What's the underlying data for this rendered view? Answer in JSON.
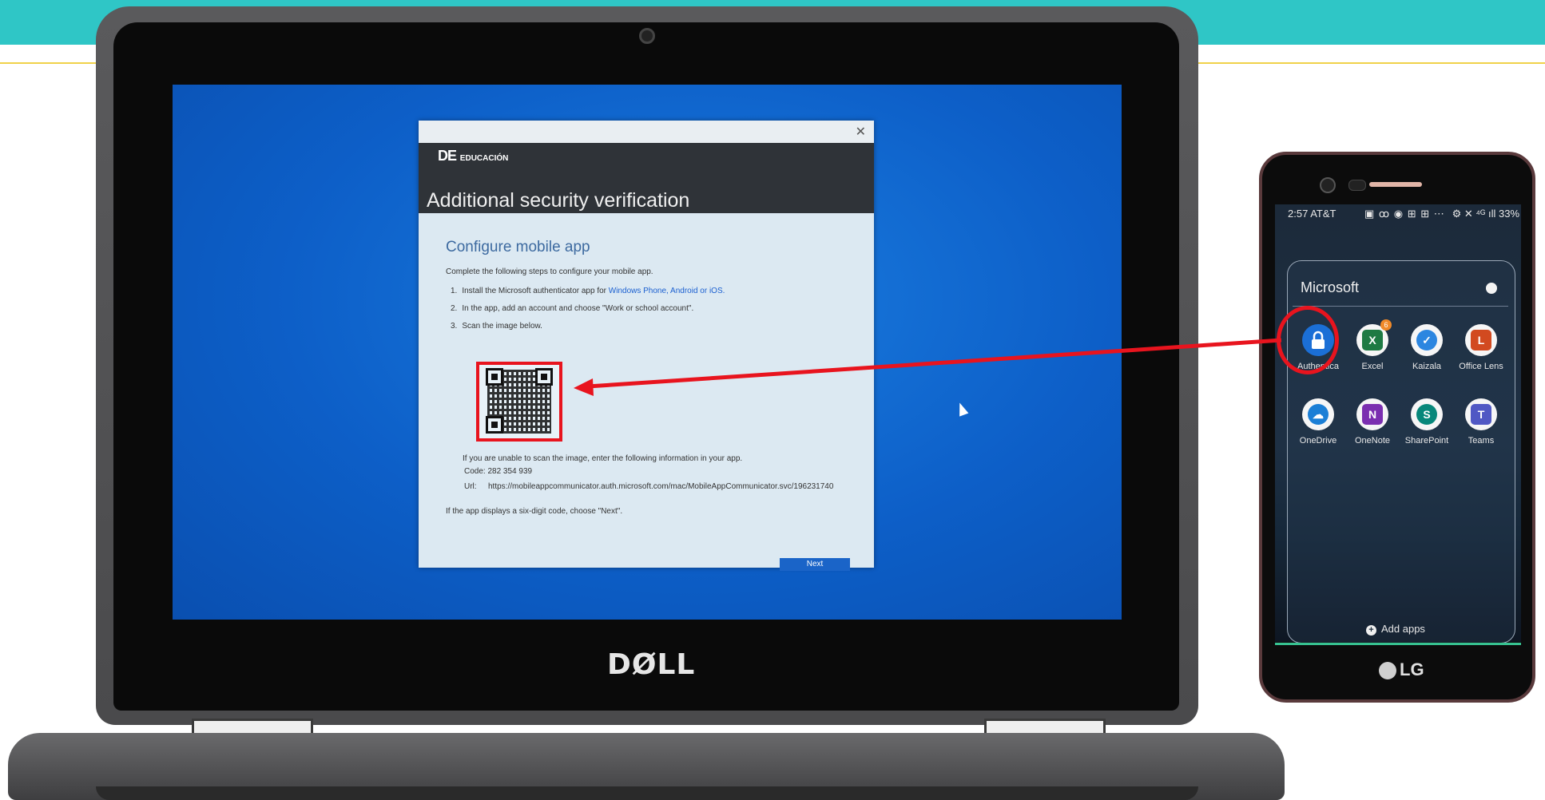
{
  "dialog": {
    "close_icon": "✕",
    "org_logo_initials": "DE",
    "org_logo_name": "EDUCACIÓN",
    "title": "Additional security verification",
    "heading": "Configure mobile app",
    "intro": "Complete the following steps to configure your mobile app.",
    "step1_prefix": "Install the Microsoft authenticator app for ",
    "step1_links": "Windows Phone, Android or iOS.",
    "step2": "In the app, add an account and choose \"Work or school account\".",
    "step3": "Scan the image below.",
    "unable_text": "If you are unable to scan the image, enter the following information in your app.",
    "code_label": "Code: 282 354 939",
    "url_label": "Url:",
    "url_value": "https://mobileappcommunicator.auth.microsoft.com/mac/MobileAppCommunicator.svc/196231740",
    "six_digit_text": "If the app displays a six-digit code, choose \"Next\".",
    "next_button": "Next"
  },
  "laptop": {
    "brand": "DØLL"
  },
  "phone": {
    "status_time": "2:57 AT&T",
    "status_icons": "▣ ꝏ ◉ ⊞ ⊞ ⋯",
    "status_right": "⚙ ✕ ⁴ᴳ ıll 33%",
    "folder_title": "Microsoft",
    "apps": [
      {
        "label": "Authentica",
        "icon": "lock-icon",
        "color": "#1b6fd6",
        "glyph": "🔒"
      },
      {
        "label": "Excel",
        "icon": "excel-icon",
        "color": "#1e7a43",
        "glyph": "X",
        "badge": "6"
      },
      {
        "label": "Kaizala",
        "icon": "kaizala-icon",
        "color": "#2c86e0",
        "glyph": "✓"
      },
      {
        "label": "Office Lens",
        "icon": "office-lens-icon",
        "color": "#d24a20",
        "glyph": "L"
      },
      {
        "label": "OneDrive",
        "icon": "onedrive-icon",
        "color": "#1b7fd6",
        "glyph": "☁"
      },
      {
        "label": "OneNote",
        "icon": "onenote-icon",
        "color": "#7b2fb0",
        "glyph": "N"
      },
      {
        "label": "SharePoint",
        "icon": "sharepoint-icon",
        "color": "#07877a",
        "glyph": "S"
      },
      {
        "label": "Teams",
        "icon": "teams-icon",
        "color": "#5058c4",
        "glyph": "T"
      }
    ],
    "add_apps": "Add apps",
    "brand": "LG"
  },
  "colors": {
    "banner": "#2fc6c6",
    "highlight_red": "#e8141e",
    "screen_blue": "#0d5fc8"
  }
}
